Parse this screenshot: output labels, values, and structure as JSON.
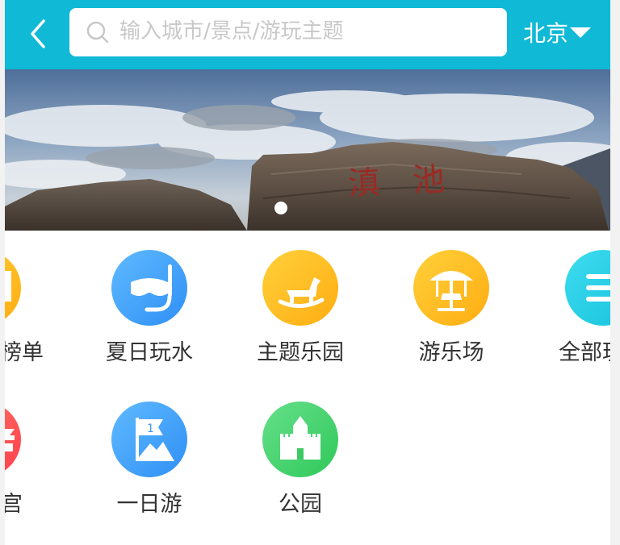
{
  "header": {
    "search_placeholder": "输入城市/景点/游玩主题",
    "city": "北京"
  },
  "banner": {
    "rock_text": "滇池"
  },
  "categories": [
    {
      "label": "榜单",
      "icon": "ranking-icon",
      "color": "#ffc21a"
    },
    {
      "label": "夏日玩水",
      "icon": "snorkel-mask-icon",
      "color": "#3aa0ff"
    },
    {
      "label": "主题乐园",
      "icon": "rocking-horse-icon",
      "color": "#ffc21a"
    },
    {
      "label": "游乐场",
      "icon": "carousel-icon",
      "color": "#ffc21a"
    },
    {
      "label": "全部玩",
      "icon": "menu-list-icon",
      "color": "#22d0e6"
    },
    {
      "label": "宫",
      "icon": "palace-icon",
      "color": "#ff5a5a"
    },
    {
      "label": "一日游",
      "icon": "flag-mountain-icon",
      "color": "#3aa0ff"
    },
    {
      "label": "公园",
      "icon": "castle-icon",
      "color": "#3fd36a"
    }
  ]
}
